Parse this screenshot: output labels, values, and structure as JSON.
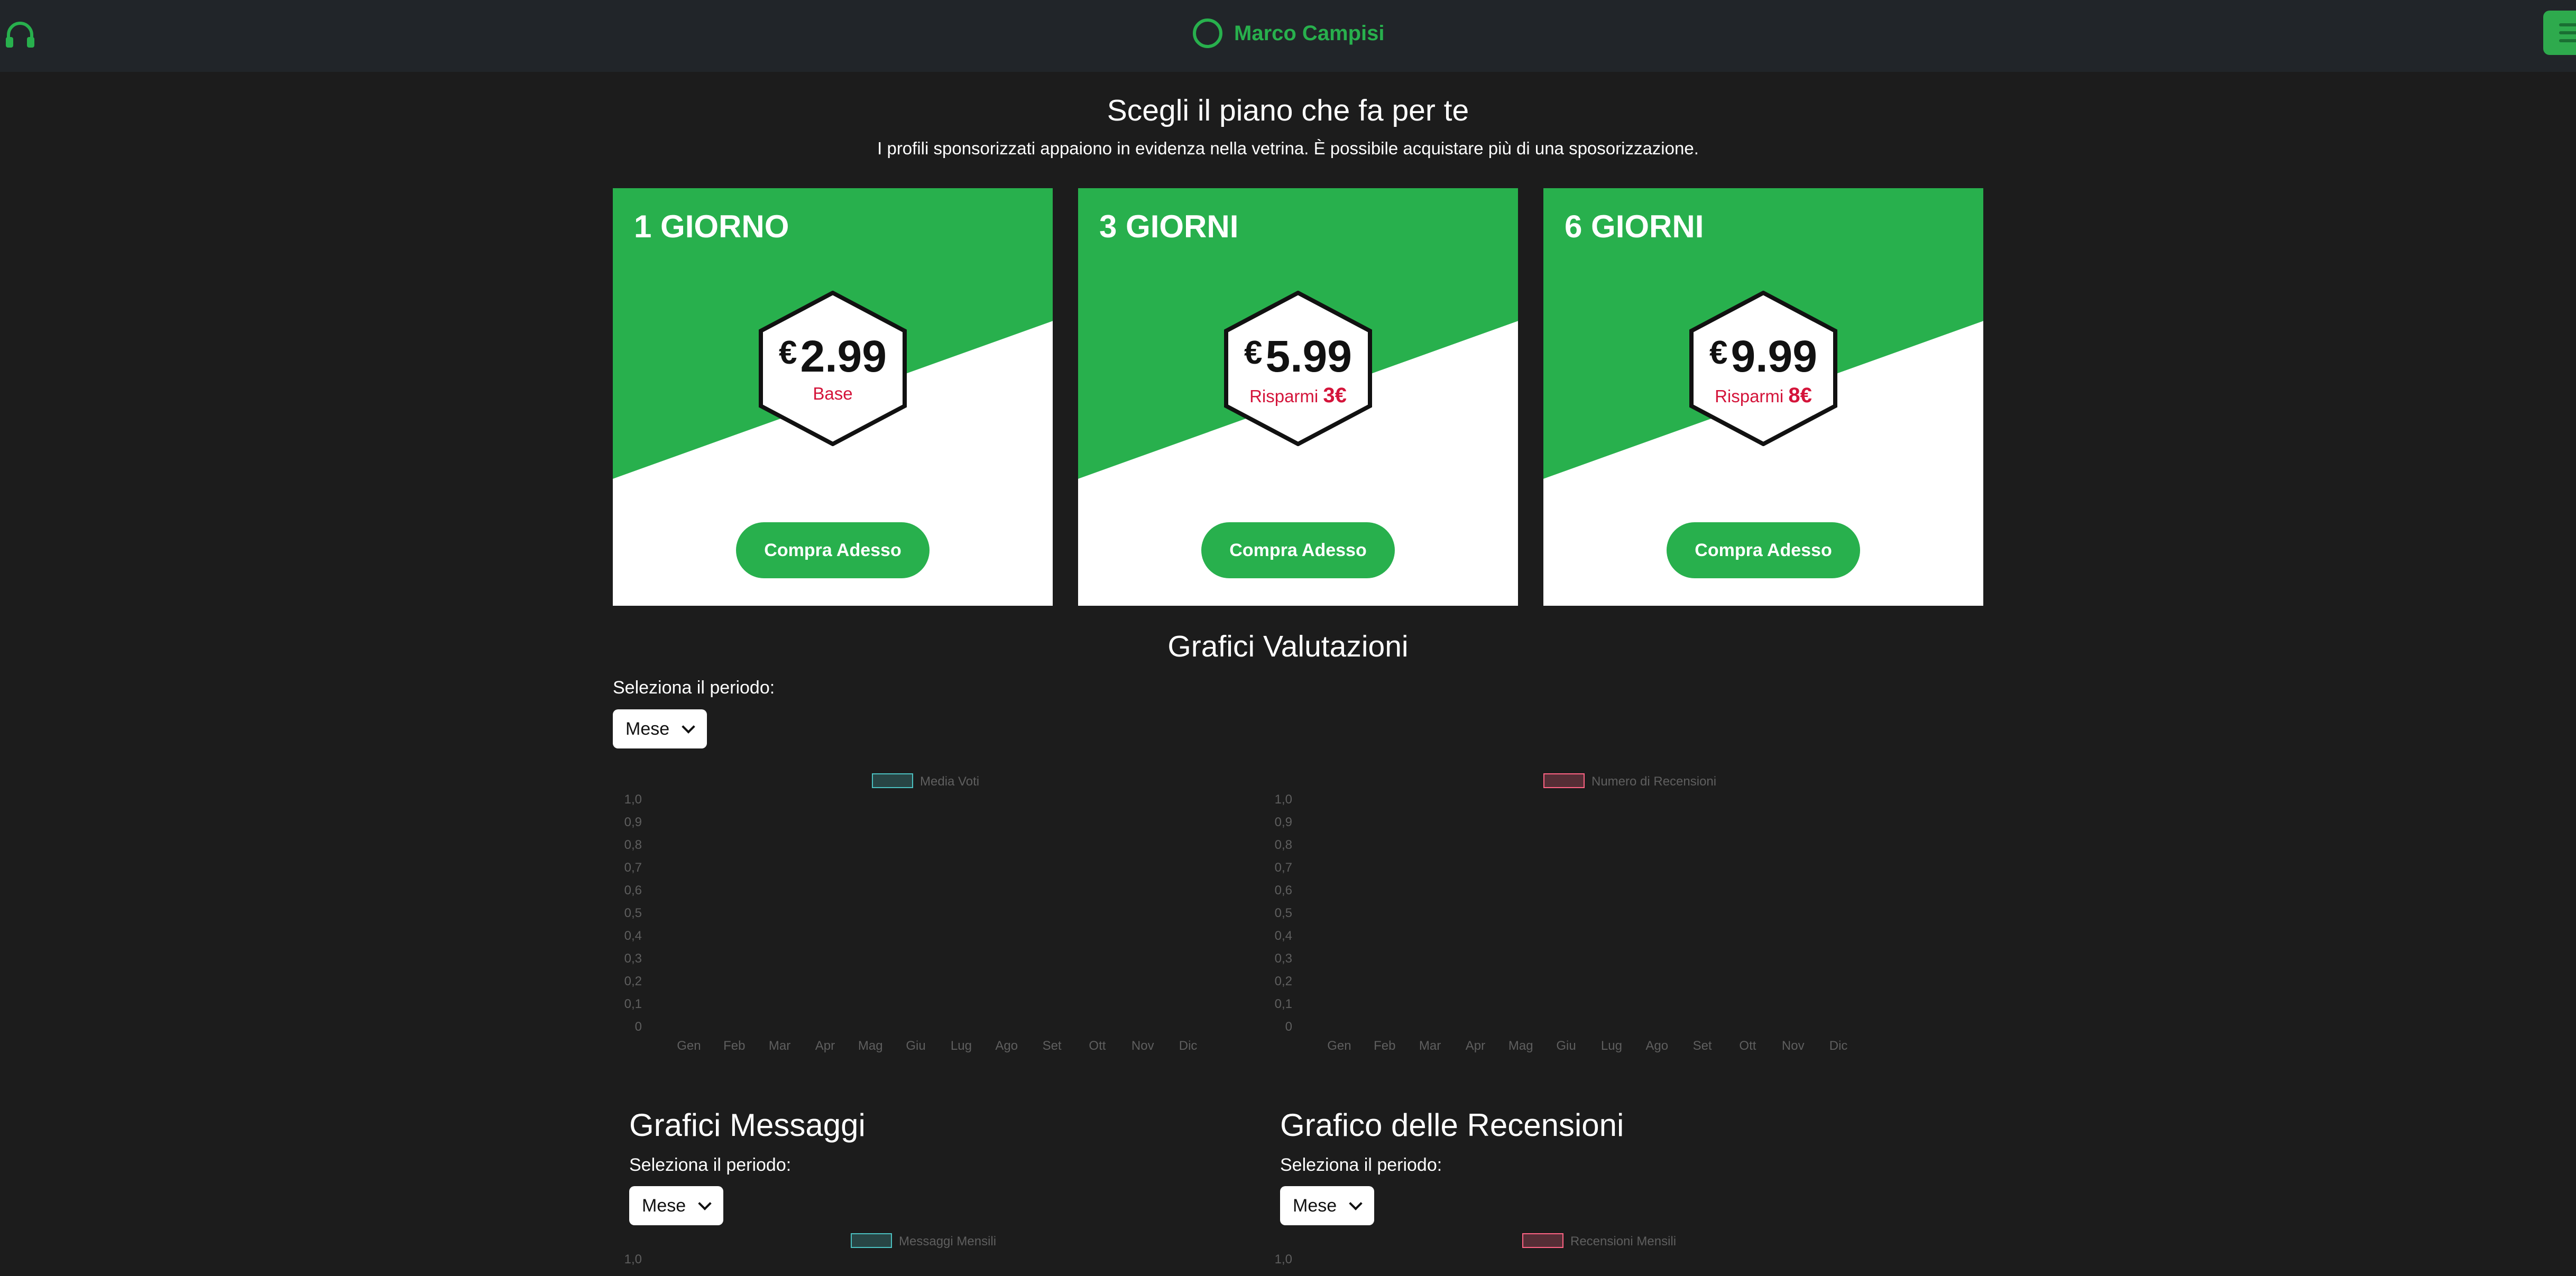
{
  "header": {
    "brand_name": "Marco Campisi"
  },
  "plans": {
    "title": "Scegli il piano che fa per te",
    "subtitle": "I profili sponsorizzati appaiono in evidenza nella vetrina. È possibile acquistare più di una sposorizzazione.",
    "currency_symbol": "€",
    "items": [
      {
        "name": "1 GIORNO",
        "price": "2.99",
        "note": "Base",
        "savings": "",
        "button": "Compra Adesso"
      },
      {
        "name": "3 GIORNI",
        "price": "5.99",
        "note": "Risparmi",
        "savings": "3€",
        "button": "Compra Adesso"
      },
      {
        "name": "6 GIORNI",
        "price": "9.99",
        "note": "Risparmi",
        "savings": "8€",
        "button": "Compra Adesso"
      }
    ]
  },
  "ratings": {
    "title": "Grafici Valutazioni",
    "period_label": "Seleziona il periodo:",
    "period_value": "Mese"
  },
  "messages_section": {
    "title": "Grafici Messaggi",
    "period_label": "Seleziona il periodo:",
    "period_value": "Mese"
  },
  "reviews_section": {
    "title": "Grafico delle Recensioni",
    "period_label": "Seleziona il periodo:",
    "period_value": "Mese"
  },
  "colors": {
    "accent": "#28b04d",
    "price_note": "#d4143a",
    "teal": "#4bc0c0",
    "red": "#ff6384"
  },
  "chart_data": [
    {
      "type": "bar",
      "legend": "Media Voti",
      "legend_color": "#4bc0c0",
      "categories": [
        "Gen",
        "Feb",
        "Mar",
        "Apr",
        "Mag",
        "Giu",
        "Lug",
        "Ago",
        "Set",
        "Ott",
        "Nov",
        "Dic"
      ],
      "series": [
        {
          "name": "Media Voti",
          "values": []
        }
      ],
      "yticks": [
        "0",
        "0,1",
        "0,2",
        "0,3",
        "0,4",
        "0,5",
        "0,6",
        "0,7",
        "0,8",
        "0,9",
        "1,0"
      ],
      "ylim": [
        0,
        1
      ]
    },
    {
      "type": "bar",
      "legend": "Numero di Recensioni",
      "legend_color": "#ff6384",
      "categories": [
        "Gen",
        "Feb",
        "Mar",
        "Apr",
        "Mag",
        "Giu",
        "Lug",
        "Ago",
        "Set",
        "Ott",
        "Nov",
        "Dic"
      ],
      "series": [
        {
          "name": "Numero di Recensioni",
          "values": []
        }
      ],
      "yticks": [
        "0",
        "0,1",
        "0,2",
        "0,3",
        "0,4",
        "0,5",
        "0,6",
        "0,7",
        "0,8",
        "0,9",
        "1,0"
      ],
      "ylim": [
        0,
        1
      ]
    },
    {
      "type": "bar",
      "legend": "Messaggi Mensili",
      "legend_color": "#4bc0c0",
      "categories": [],
      "series": [
        {
          "name": "Messaggi Mensili",
          "values": []
        }
      ],
      "yticks": [
        "1,0"
      ],
      "ylim": [
        0,
        1
      ]
    },
    {
      "type": "bar",
      "legend": "Recensioni Mensili",
      "legend_color": "#ff6384",
      "categories": [],
      "series": [
        {
          "name": "Recensioni Mensili",
          "values": []
        }
      ],
      "yticks": [
        "1,0"
      ],
      "ylim": [
        0,
        1
      ]
    }
  ]
}
